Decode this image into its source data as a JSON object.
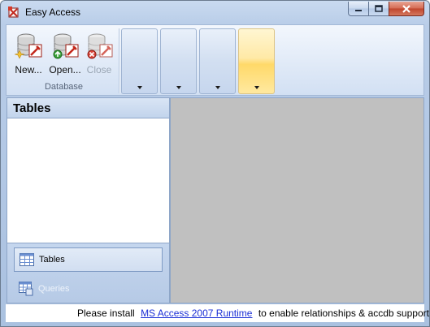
{
  "window": {
    "title": "Easy Access",
    "icon": "easy-access-app-icon"
  },
  "caption_buttons": {
    "minimize_icon": "minimize-icon",
    "maximize_icon": "maximize-icon",
    "close_icon": "close-icon"
  },
  "ribbon": {
    "database_group": {
      "label": "Database",
      "buttons": [
        {
          "label": "New...",
          "icon": "database-new-icon",
          "enabled": true
        },
        {
          "label": "Open...",
          "icon": "database-open-icon",
          "enabled": true
        },
        {
          "label": "Close",
          "icon": "database-close-icon",
          "enabled": false
        }
      ]
    },
    "split_buttons": [
      {
        "label": "",
        "active": false
      },
      {
        "label": "",
        "active": false
      },
      {
        "label": "",
        "active": false
      },
      {
        "label": "",
        "active": true
      }
    ]
  },
  "navigation": {
    "header": "Tables",
    "items": [
      {
        "label": "Tables",
        "icon": "table-grid-icon",
        "selected": true
      },
      {
        "label": "Queries",
        "icon": "query-grid-icon",
        "selected": false
      }
    ]
  },
  "status": {
    "prefix": "Please install",
    "link": "MS Access 2007 Runtime",
    "suffix": "to enable relationships & accdb support!"
  },
  "colors": {
    "workspace": "#c0c0c0",
    "link": "#1b2fd6",
    "active_button": "#ffd969"
  }
}
